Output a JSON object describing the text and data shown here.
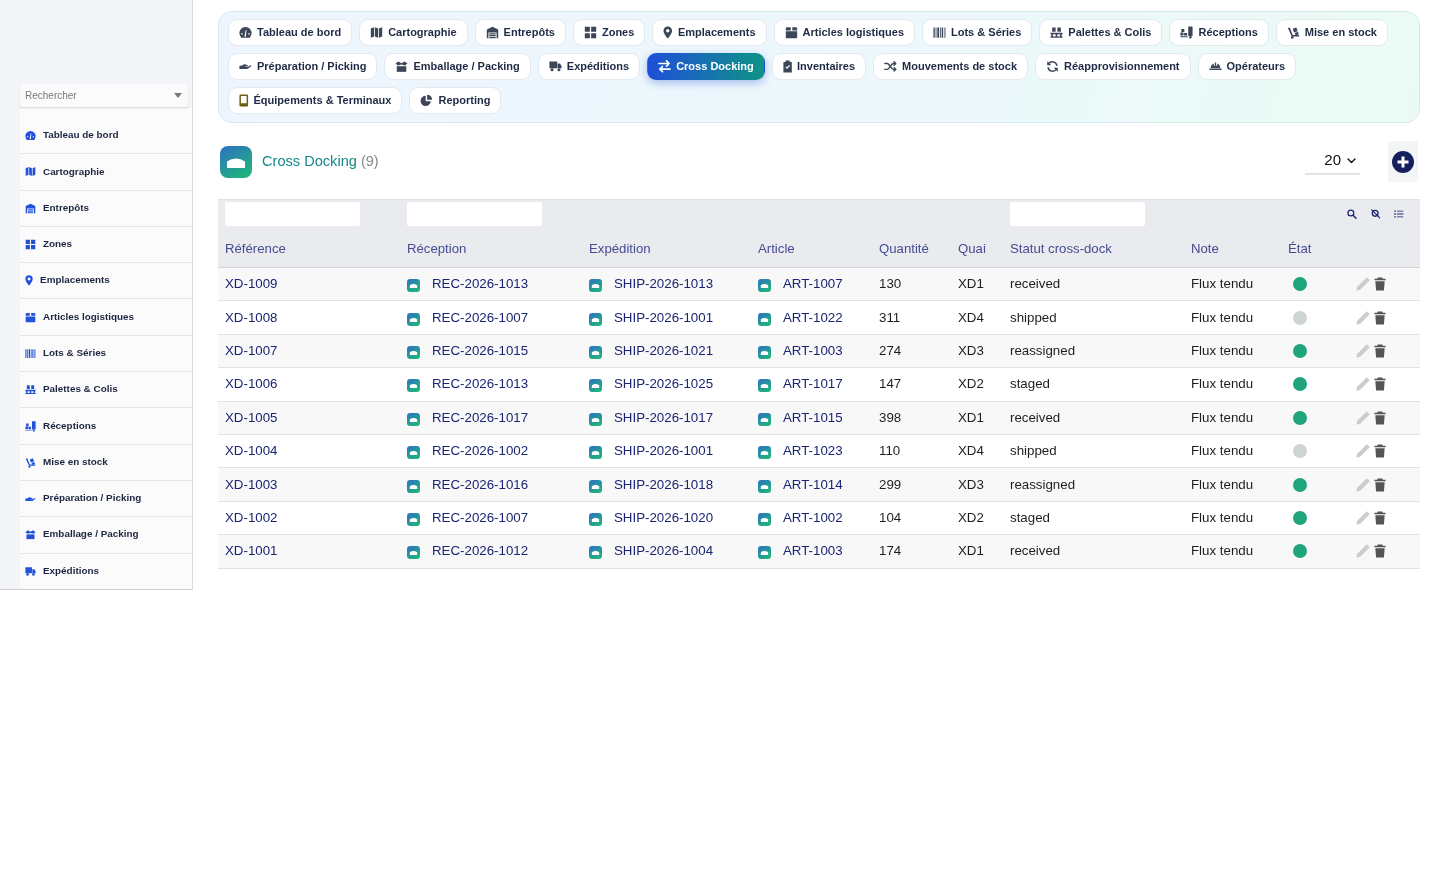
{
  "sidebar": {
    "search": {
      "placeholder": "Rechercher"
    },
    "items": [
      {
        "label": "Tableau de bord",
        "selected": false
      },
      {
        "label": "Cartographie",
        "selected": false
      },
      {
        "label": "Entrepôts",
        "selected": false
      },
      {
        "label": "Zones",
        "selected": false
      },
      {
        "label": "Emplacements",
        "selected": false
      },
      {
        "label": "Articles logistiques",
        "selected": false
      },
      {
        "label": "Lots & Séries",
        "selected": false
      },
      {
        "label": "Palettes & Colis",
        "selected": false
      },
      {
        "label": "Réceptions",
        "selected": false
      },
      {
        "label": "Mise en stock",
        "selected": false
      },
      {
        "label": "Préparation / Picking",
        "selected": false
      },
      {
        "label": "Emballage / Packing",
        "selected": false
      },
      {
        "label": "Expéditions",
        "selected": false
      }
    ]
  },
  "tabs": [
    {
      "label": "Tableau de bord",
      "selected": false
    },
    {
      "label": "Cartographie",
      "selected": false
    },
    {
      "label": "Entrepôts",
      "selected": false
    },
    {
      "label": "Zones",
      "selected": false
    },
    {
      "label": "Emplacements",
      "selected": false
    },
    {
      "label": "Articles logistiques",
      "selected": false
    },
    {
      "label": "Lots & Séries",
      "selected": false
    },
    {
      "label": "Palettes & Colis",
      "selected": false
    },
    {
      "label": "Réceptions",
      "selected": false
    },
    {
      "label": "Mise en stock",
      "selected": false
    },
    {
      "label": "Préparation / Picking",
      "selected": false
    },
    {
      "label": "Emballage / Packing",
      "selected": false
    },
    {
      "label": "Expéditions",
      "selected": false
    },
    {
      "label": "Cross Docking",
      "selected": true
    },
    {
      "label": "Inventaires",
      "selected": false
    },
    {
      "label": "Mouvements de stock",
      "selected": false
    },
    {
      "label": "Réapprovisionnement",
      "selected": false
    },
    {
      "label": "Opérateurs",
      "selected": false
    },
    {
      "label": "Équipements & Terminaux",
      "selected": false
    },
    {
      "label": "Reporting",
      "selected": false
    }
  ],
  "header": {
    "title": "Cross Docking",
    "count": "(9)",
    "page_size": "20"
  },
  "table": {
    "columns": [
      {
        "label": "Référence",
        "kind": "link",
        "filter": true
      },
      {
        "label": "Réception",
        "kind": "icon-link",
        "filter": true
      },
      {
        "label": "Expédition",
        "kind": "icon-link",
        "filter": false
      },
      {
        "label": "Article",
        "kind": "icon-link",
        "filter": false
      },
      {
        "label": "Quantité",
        "kind": "text",
        "filter": false
      },
      {
        "label": "Quai",
        "kind": "text",
        "filter": false
      },
      {
        "label": "Statut cross-dock",
        "kind": "text",
        "filter": true
      },
      {
        "label": "Note",
        "kind": "text",
        "filter": false
      },
      {
        "label": "État",
        "kind": "dot",
        "filter": false
      }
    ],
    "rows": [
      {
        "cells": [
          "XD-1009",
          "REC-2026-1013",
          "SHIP-2026-1013",
          "ART-1007",
          "130",
          "XD1",
          "received",
          "Flux tendu"
        ],
        "color": "#20a47b"
      },
      {
        "cells": [
          "XD-1008",
          "REC-2026-1007",
          "SHIP-2026-1001",
          "ART-1022",
          "311",
          "XD4",
          "shipped",
          "Flux tendu"
        ],
        "color": "#cdd4d3"
      },
      {
        "cells": [
          "XD-1007",
          "REC-2026-1015",
          "SHIP-2026-1021",
          "ART-1003",
          "274",
          "XD3",
          "reassigned",
          "Flux tendu"
        ],
        "color": "#20a47b"
      },
      {
        "cells": [
          "XD-1006",
          "REC-2026-1013",
          "SHIP-2026-1025",
          "ART-1017",
          "147",
          "XD2",
          "staged",
          "Flux tendu"
        ],
        "color": "#20a47b"
      },
      {
        "cells": [
          "XD-1005",
          "REC-2026-1017",
          "SHIP-2026-1017",
          "ART-1015",
          "398",
          "XD1",
          "received",
          "Flux tendu"
        ],
        "color": "#20a47b"
      },
      {
        "cells": [
          "XD-1004",
          "REC-2026-1002",
          "SHIP-2026-1001",
          "ART-1023",
          "110",
          "XD4",
          "shipped",
          "Flux tendu"
        ],
        "color": "#cdd4d3"
      },
      {
        "cells": [
          "XD-1003",
          "REC-2026-1016",
          "SHIP-2026-1018",
          "ART-1014",
          "299",
          "XD3",
          "reassigned",
          "Flux tendu"
        ],
        "color": "#20a47b"
      },
      {
        "cells": [
          "XD-1002",
          "REC-2026-1007",
          "SHIP-2026-1020",
          "ART-1002",
          "104",
          "XD2",
          "staged",
          "Flux tendu"
        ],
        "color": "#20a47b"
      },
      {
        "cells": [
          "XD-1001",
          "REC-2026-1012",
          "SHIP-2026-1004",
          "ART-1003",
          "174",
          "XD1",
          "received",
          "Flux tendu"
        ],
        "color": "#20a47b"
      }
    ]
  }
}
